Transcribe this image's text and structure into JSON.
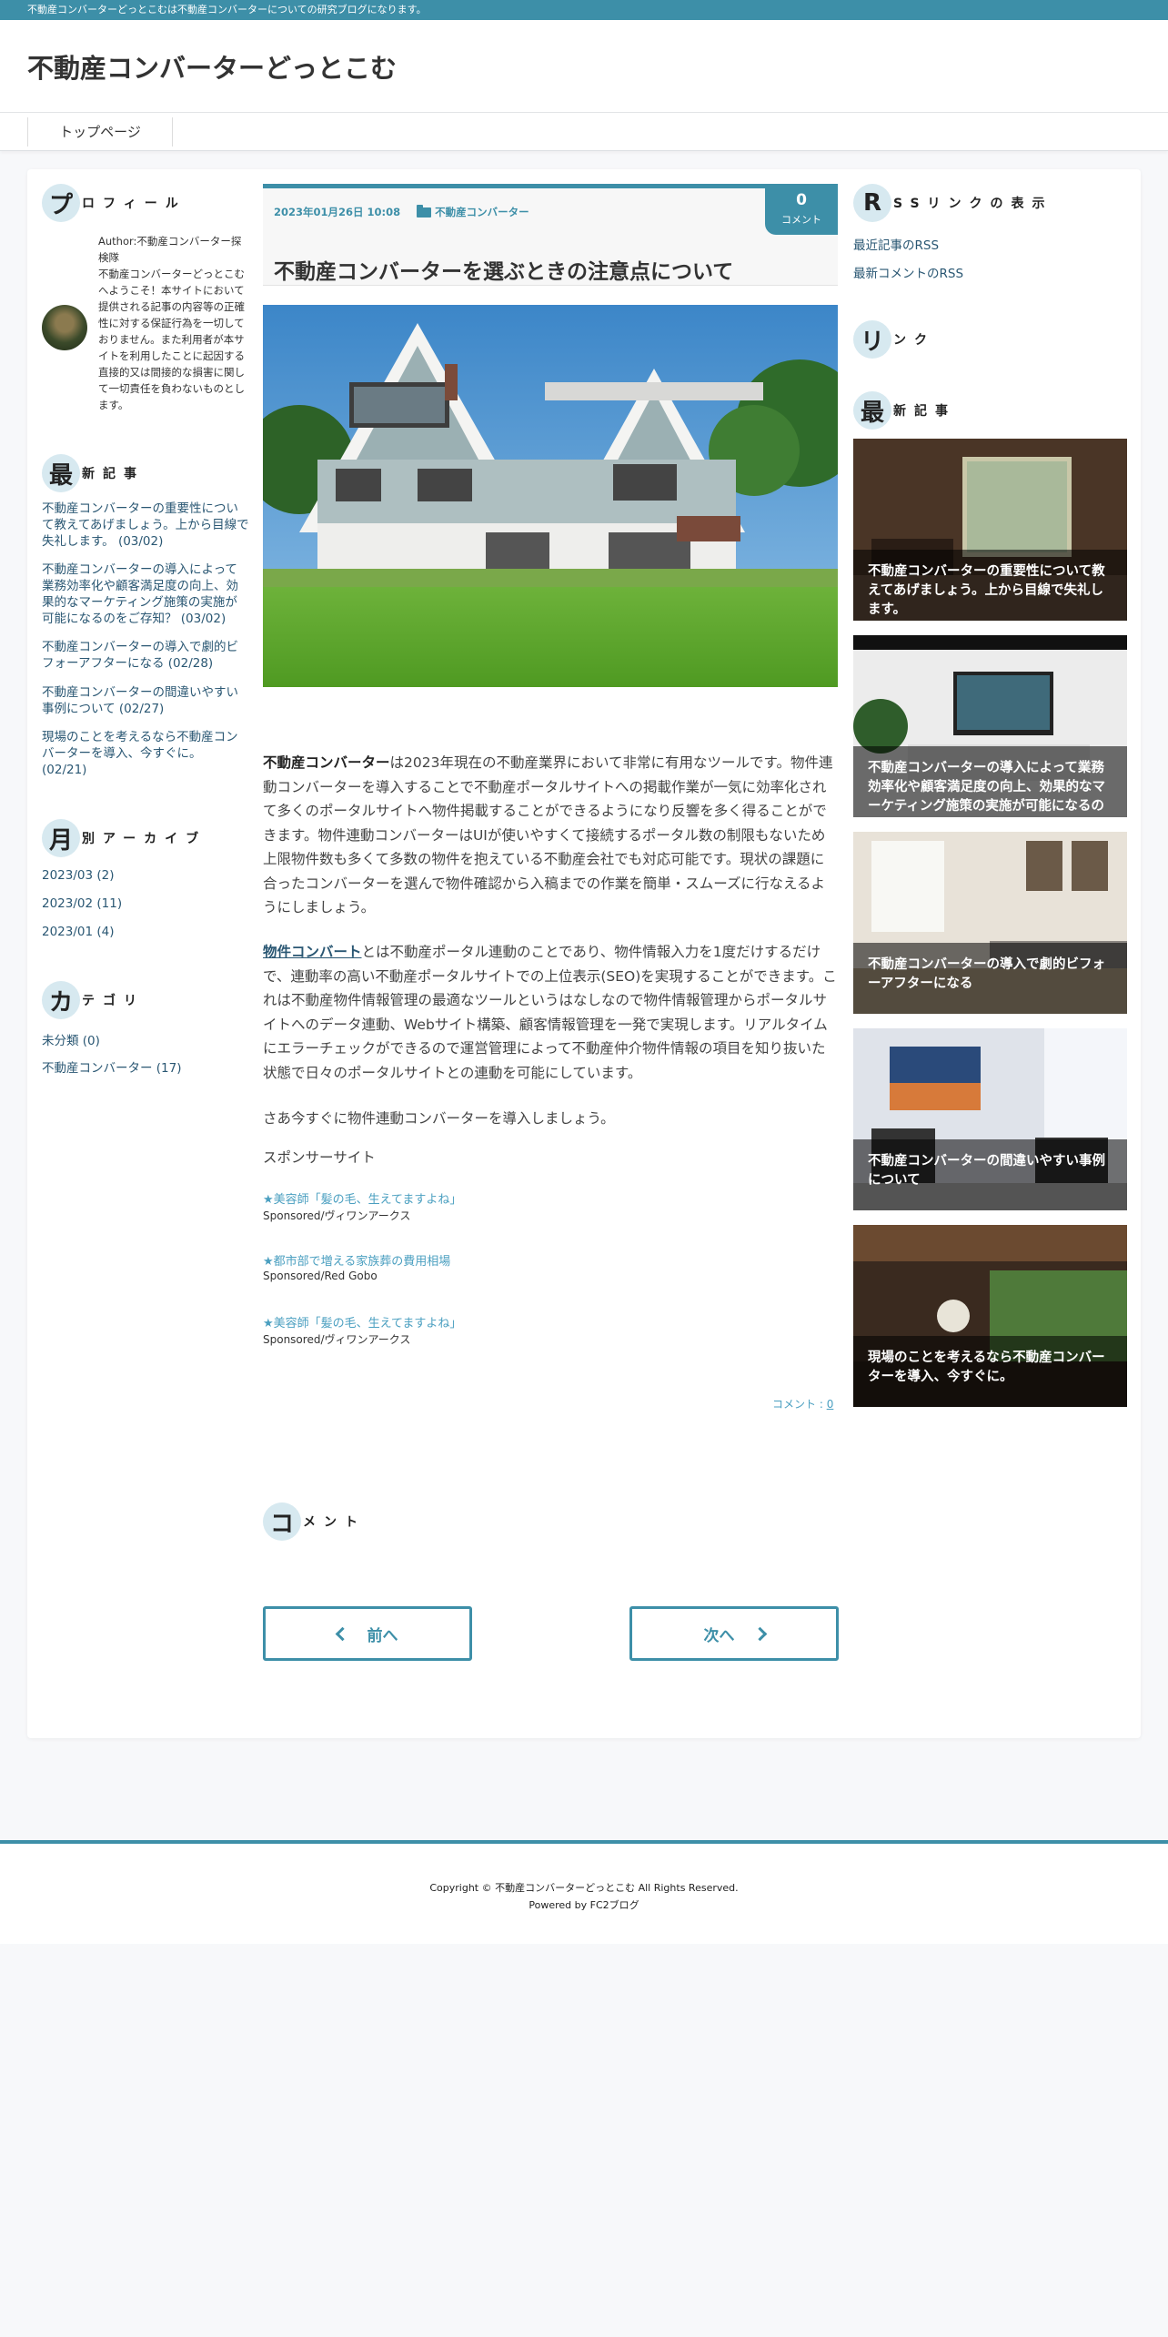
{
  "topbar": {
    "text": "不動産コンバーターどっとこむは不動産コンバーターについての研究ブログになります。"
  },
  "site": {
    "title": "不動産コンバーターどっとこむ"
  },
  "nav": {
    "items": [
      {
        "label": "トップページ"
      }
    ]
  },
  "colors": {
    "accent": "#3d8fa8",
    "link": "#2a5773",
    "sponsor_link": "#4a9fc0",
    "heading_circle": "#d7e9f0"
  },
  "left": {
    "profile": {
      "head_char": "プ",
      "head_rest": "ロフィール",
      "text": "Author:不動産コンバーター探検隊\n不動産コンバーターどっとこむへようこそ！本サイトにおいて提供される記事の内容等の正確性に対する保証行為を一切しておりません。また利用者が本サイトを利用したことに起因する直接的又は間接的な損害に関して一切責任を負わないものとします。"
    },
    "recent": {
      "head_char": "最",
      "head_rest": "新記事",
      "items": [
        {
          "label": "不動産コンバーターの重要性について教えてあげましょう。上から目線で失礼します。 (03/02)"
        },
        {
          "label": "不動産コンバーターの導入によって業務効率化や顧客満足度の向上、効果的なマーケティング施策の実施が可能になるのをご存知？ (03/02)"
        },
        {
          "label": "不動産コンバーターの導入で劇的ビフォーアフターになる (02/28)"
        },
        {
          "label": "不動産コンバーターの間違いやすい事例について (02/27)"
        },
        {
          "label": "現場のことを考えるなら不動産コンバーターを導入、今すぐに。 (02/21)"
        }
      ]
    },
    "archive": {
      "head_char": "月",
      "head_rest": "別アーカイブ",
      "items": [
        {
          "label": "2023/03 (2)"
        },
        {
          "label": "2023/02 (11)"
        },
        {
          "label": "2023/01 (4)"
        }
      ]
    },
    "category": {
      "head_char": "カ",
      "head_rest": "テゴリ",
      "items": [
        {
          "label": "未分類 (0)"
        },
        {
          "label": "不動産コンバーター (17)"
        }
      ]
    }
  },
  "article": {
    "date": "2023年01月26日 10:08",
    "category": "不動産コンバーター",
    "comment_count": "0",
    "comment_label": "コメント",
    "title": "不動産コンバーターを選ぶときの注意点について",
    "p1_bold": "不動産コンバーター",
    "p1_rest": "は2023年現在の不動産業界において非常に有用なツールです。物件連動コンバーターを導入することで不動産ポータルサイトへの掲載作業が一気に効率化されて多くのポータルサイトへ物件掲載することができるようになり反響を多く得ることができます。物件連動コンバーターはUIが使いやすくて接続するポータル数の制限もないため上限物件数も多くて多数の物件を抱えている不動産会社でも対応可能です。現状の課題に合ったコンバーターを選んで物件確認から入稿までの作業を簡単・スムーズに行なえるようにしましょう。",
    "p2_link": "物件コンバート",
    "p2_rest": "とは不動産ポータル連動のことであり、物件情報入力を1度だけするだけで、連動率の高い不動産ポータルサイトでの上位表示(SEO)を実現することができます。これは不動産物件情報管理の最適なツールというはなしなので物件情報管理からポータルサイトへのデータ連動、Webサイト構築、顧客情報管理を一発で実現します。リアルタイムにエラーチェックができるので運営管理によって不動産仲介物件情報の項目を知り抜いた状態で日々のポータルサイトとの連動を可能にしています。",
    "p3": "さあ今すぐに物件連動コンバーターを導入しましょう。",
    "sponsor_head": "スポンサーサイト",
    "sponsors": [
      {
        "link": "★美容師「髪の毛、生えてますよね」",
        "by": "Sponsored/ヴィワンアークス"
      },
      {
        "link": "★都市部で増える家族葬の費用相場",
        "by": "Sponsored/Red Gobo"
      },
      {
        "link": "★美容師「髪の毛、生えてますよね」",
        "by": "Sponsored/ヴィワンアークス"
      }
    ],
    "comment_link_prefix": "コメント : ",
    "comment_link_count": "0"
  },
  "comments": {
    "head_char": "コ",
    "head_rest": "メント"
  },
  "pager": {
    "prev": "前へ",
    "next": "次へ"
  },
  "right": {
    "rss": {
      "head_char": "R",
      "head_rest": "SSリンクの表示",
      "items": [
        {
          "label": "最近記事のRSS"
        },
        {
          "label": "最新コメントのRSS"
        }
      ]
    },
    "links": {
      "head_char": "リ",
      "head_rest": "ンク"
    },
    "recent": {
      "head_char": "最",
      "head_rest": "新記事",
      "cards": [
        {
          "caption": "不動産コンバーターの重要性について教えてあげましょう。上から目線で失礼します。"
        },
        {
          "caption": "不動産コンバーターの導入によって業務効率化や顧客満足度の向上、効果的なマーケティング施策の実施が可能になるの"
        },
        {
          "caption": "不動産コンバーターの導入で劇的ビフォーアフターになる"
        },
        {
          "caption": "不動産コンバーターの間違いやすい事例について"
        },
        {
          "caption": "現場のことを考えるなら不動産コンバーターを導入、今すぐに。"
        }
      ]
    }
  },
  "footer": {
    "copyright": "Copyright © 不動産コンバーターどっとこむ All Rights Reserved.",
    "powered": "Powered by FC2ブログ"
  }
}
